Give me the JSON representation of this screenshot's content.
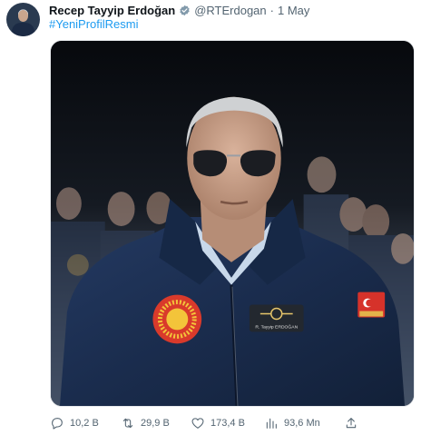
{
  "tweet": {
    "author_name": "Recep Tayyip Erdoğan",
    "handle": "@RTErdogan",
    "separator": "·",
    "date": "1 May",
    "text": "#YeniProfilResmi",
    "verified": true,
    "colors": {
      "link": "#1d9bf0",
      "text": "#0f1419",
      "secondary": "#536471",
      "verified_badge": "#829aab"
    }
  },
  "actions": {
    "reply": {
      "icon": "reply-icon",
      "count": "10,2 B"
    },
    "retweet": {
      "icon": "retweet-icon",
      "count": "29,9 B"
    },
    "like": {
      "icon": "heart-icon",
      "count": "173,4 B"
    },
    "views": {
      "icon": "views-chart-icon",
      "count": "93,6 Mn"
    },
    "share": {
      "icon": "share-icon"
    }
  },
  "media": {
    "type": "photo",
    "patch_text": "R. Tayyip ERDOĞAN"
  }
}
